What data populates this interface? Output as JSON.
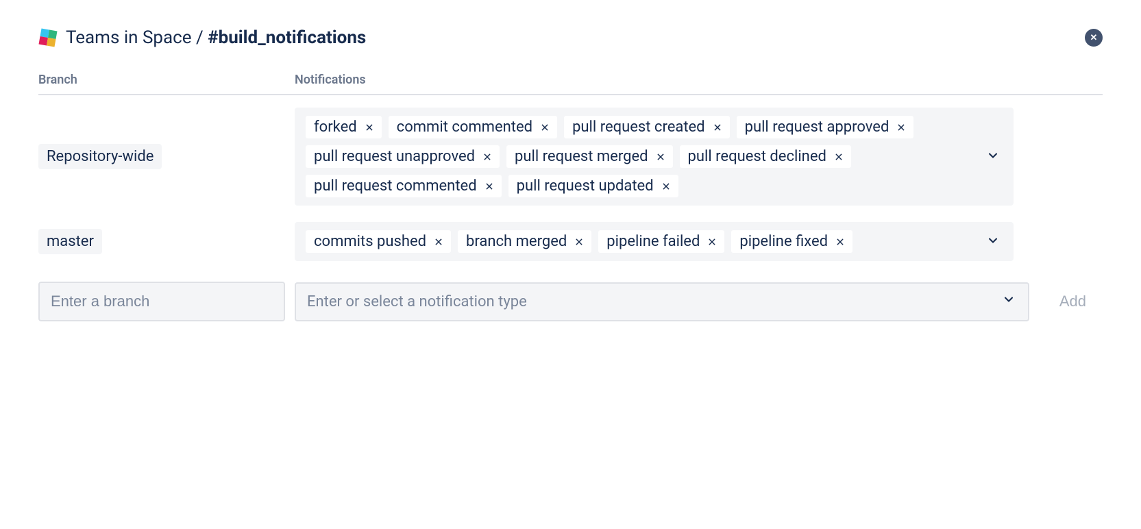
{
  "header": {
    "team": "Teams in Space",
    "separator": " / ",
    "channel": "#build_notifications"
  },
  "columns": {
    "branch": "Branch",
    "notifications": "Notifications"
  },
  "rows": [
    {
      "branch": "Repository-wide",
      "tags": [
        "forked",
        "commit commented",
        "pull request created",
        "pull request approved",
        "pull request unapproved",
        "pull request merged",
        "pull request declined",
        "pull request commented",
        "pull request updated"
      ]
    },
    {
      "branch": "master",
      "tags": [
        "commits pushed",
        "branch merged",
        "pipeline failed",
        "pipeline fixed"
      ]
    }
  ],
  "add": {
    "branch_placeholder": "Enter a branch",
    "notif_placeholder": "Enter or select a notification type",
    "button": "Add"
  }
}
